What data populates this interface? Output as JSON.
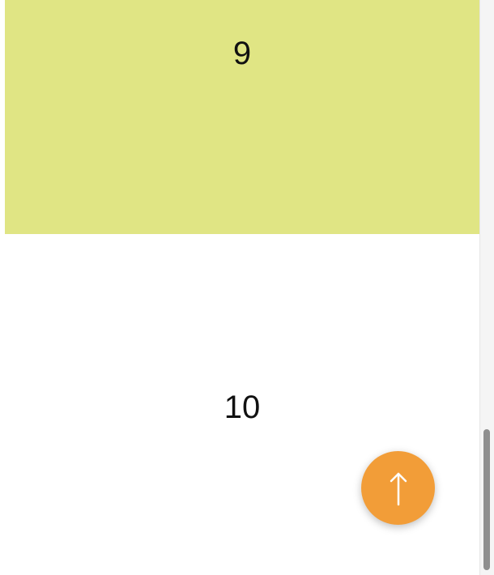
{
  "sections": [
    {
      "label": "9",
      "background": "#e0e584"
    },
    {
      "label": "10",
      "background": "#ffffff"
    }
  ],
  "scroll_to_top_button": {
    "icon": "arrow-up-icon",
    "background": "#f29d38",
    "icon_color": "#ffffff"
  },
  "scrollbar": {
    "track_color": "#f5f5f5",
    "thumb_color": "#8f8f8f"
  }
}
